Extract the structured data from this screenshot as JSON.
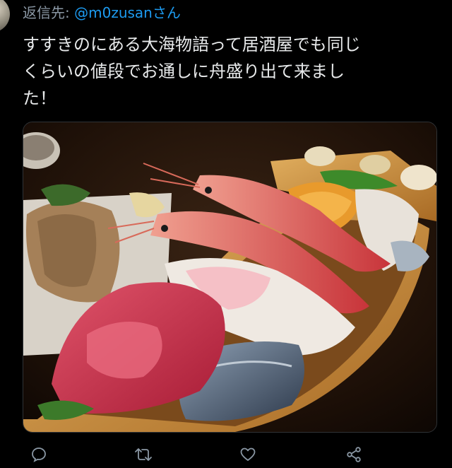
{
  "tweet": {
    "reply_prefix": "返信先: ",
    "reply_handle": "@m0zusanさん",
    "text_lines": [
      "すすきのにある大海物語って居酒屋でも同じ",
      "くらいの値段でお通しに舟盛り出て来まし",
      "た！"
    ]
  },
  "media": {
    "subject": "sashimi-boat-photo"
  },
  "actions": {
    "reply_icon": "reply-icon",
    "retweet_icon": "retweet-icon",
    "like_icon": "heart-icon",
    "share_icon": "share-icon"
  },
  "colors": {
    "background": "#000000",
    "text": "#e7e9ea",
    "secondary": "#8b98a5",
    "link": "#1d9bf0"
  }
}
